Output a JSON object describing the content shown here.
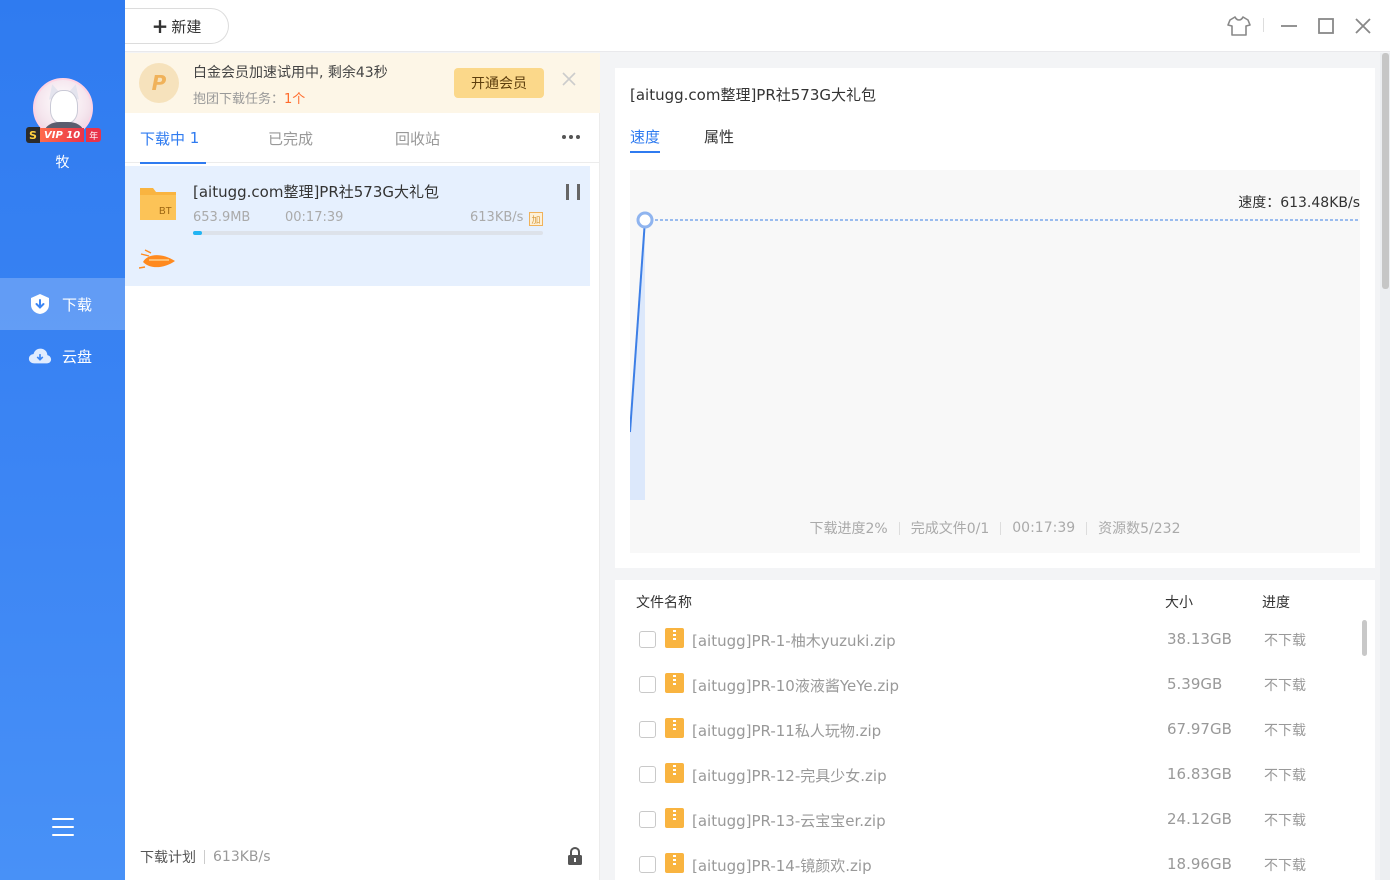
{
  "sidebar": {
    "username": "牧",
    "vip": {
      "s": "S",
      "label": "VIP 10",
      "year": "年"
    },
    "items": [
      {
        "label": "下载",
        "icon": "download-shield-icon",
        "active": true
      },
      {
        "label": "云盘",
        "icon": "cloud-icon",
        "active": false
      }
    ]
  },
  "topbar": {
    "new_button": "新建",
    "controls": [
      "skin-icon",
      "minimize-icon",
      "maximize-icon",
      "close-icon"
    ]
  },
  "banner": {
    "logo_letter": "P",
    "line1": "白金会员加速试用中, 剩余43秒",
    "line2_prefix": "抱团下载任务：",
    "line2_count": "1个",
    "button": "开通会员"
  },
  "tabs": [
    {
      "label": "下载中",
      "count": "1",
      "active": true
    },
    {
      "label": "已完成",
      "active": false
    },
    {
      "label": "回收站",
      "active": false
    }
  ],
  "download": {
    "name": "[aitugg.com整理]PR社573G大礼包",
    "badge": "BT",
    "size": "653.9MB",
    "time": "00:17:39",
    "speed": "613KB/s",
    "progress": 0.027
  },
  "footer": {
    "plan": "下载计划",
    "speed": "613KB/s"
  },
  "detail": {
    "title": "[aitugg.com整理]PR社573G大礼包",
    "tabs": [
      {
        "label": "速度",
        "active": true
      },
      {
        "label": "属性",
        "active": false
      }
    ],
    "speed_label": "速度：613.48KB/s",
    "stats": [
      "下载进度2%",
      "完成文件0/1",
      "00:17:39",
      "资源数5/232"
    ]
  },
  "files": {
    "headers": {
      "name": "文件名称",
      "size": "大小",
      "progress": "进度"
    },
    "rows": [
      {
        "name": "[aitugg]PR-1-柚木yuzuki.zip",
        "size": "38.13GB",
        "progress": "不下载"
      },
      {
        "name": "[aitugg]PR-10液液酱YeYe.zip",
        "size": "5.39GB",
        "progress": "不下载"
      },
      {
        "name": "[aitugg]PR-11私人玩物.zip",
        "size": "67.97GB",
        "progress": "不下载"
      },
      {
        "name": "[aitugg]PR-12-完具少女.zip",
        "size": "16.83GB",
        "progress": "不下载"
      },
      {
        "name": "[aitugg]PR-13-云宝宝er.zip",
        "size": "24.12GB",
        "progress": "不下载"
      },
      {
        "name": "[aitugg]PR-14-镜颜欢.zip",
        "size": "18.96GB",
        "progress": "不下载"
      }
    ]
  },
  "colors": {
    "accent": "#2f7bf0",
    "vip_gold": "#fbd88a",
    "progress": "#22b4f3"
  }
}
